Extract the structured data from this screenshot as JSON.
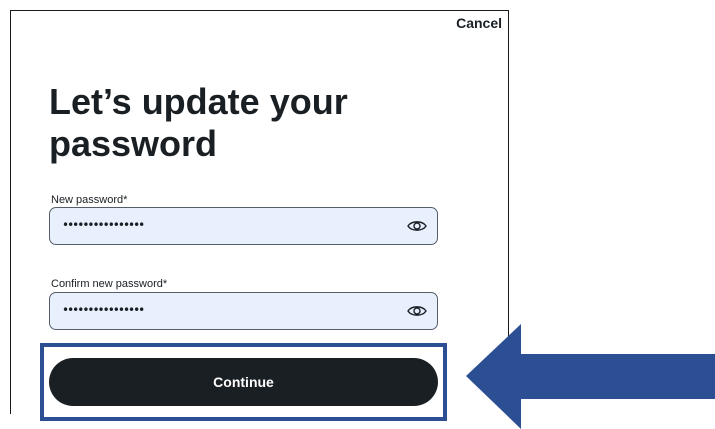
{
  "dialog": {
    "cancel_label": "Cancel",
    "title": "Let’s update your password"
  },
  "form": {
    "new_password": {
      "label": "New password*",
      "value": "••••••••••••••••",
      "toggle_icon": "eye-icon"
    },
    "confirm_password": {
      "label": "Confirm new password*",
      "value": "••••••••••••••••",
      "toggle_icon": "eye-icon"
    },
    "continue_label": "Continue"
  },
  "annotation": {
    "arrow_icon": "left-arrow-icon",
    "color": "#2c4f94"
  },
  "colors": {
    "button_bg": "#1a1f24",
    "input_bg": "#e8f0fe"
  }
}
